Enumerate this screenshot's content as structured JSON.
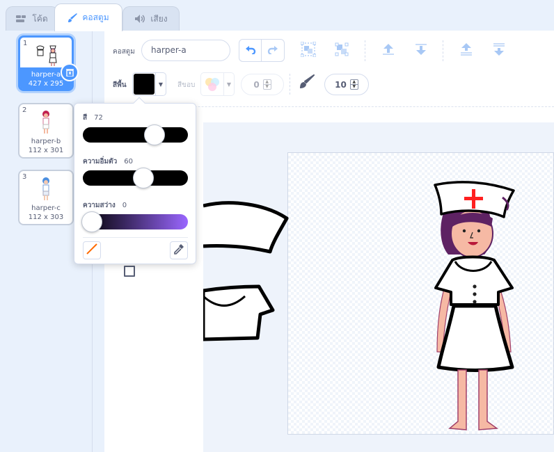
{
  "tabs": [
    {
      "label": "โค้ด",
      "icon": "code-blocks-icon"
    },
    {
      "label": "คอสตูม",
      "icon": "brush-icon"
    },
    {
      "label": "เสียง",
      "icon": "speaker-icon"
    }
  ],
  "costumes": [
    {
      "number": "1",
      "name": "harper-a",
      "size": "427 x 295"
    },
    {
      "number": "2",
      "name": "harper-b",
      "size": "112 x 301"
    },
    {
      "number": "3",
      "name": "harper-c",
      "size": "112 x 303"
    }
  ],
  "toolbar": {
    "costume_label": "คอสตูม",
    "costume_name": "harper-a",
    "fill_label": "สีพื้น",
    "outline_label": "สีขอบ",
    "outline_width": "0",
    "brush_size": "10"
  },
  "colors": {
    "accent": "#4c97ff",
    "fill_color": "#000000",
    "cross": "#ff2020"
  },
  "color_picker": {
    "hue_label": "สี",
    "hue_value": "72",
    "saturation_label": "ความอิ่มตัว",
    "saturation_value": "60",
    "brightness_label": "ความสว่าง",
    "brightness_value": "0"
  }
}
